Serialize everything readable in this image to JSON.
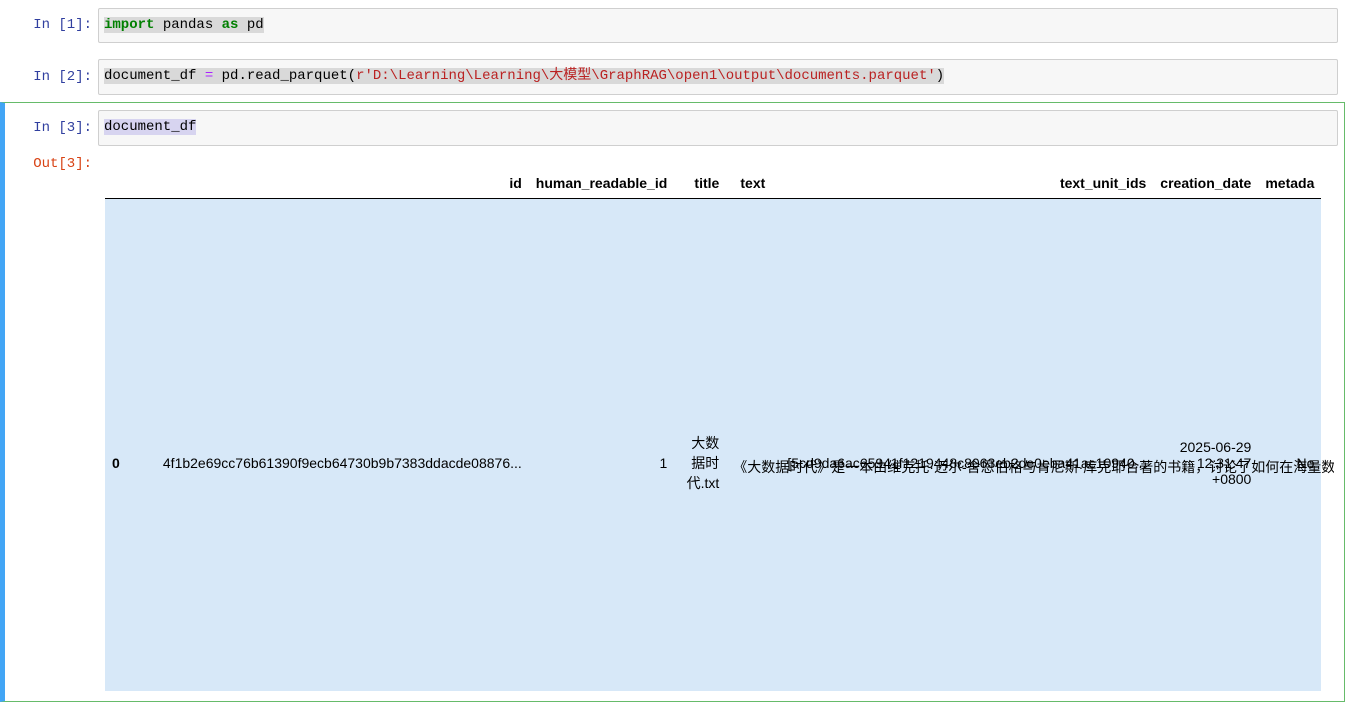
{
  "cells": [
    {
      "prompt": "In  [1]:",
      "code": {
        "kw1": "import",
        "mid": " pandas ",
        "kw2": "as",
        "end": " pd"
      }
    },
    {
      "prompt": "In  [2]:",
      "code": {
        "lhs": "document_df ",
        "eq": "=",
        "call": " pd.read_parquet(",
        "str": "r'D:\\Learning\\Learning\\大模型\\GraphRAG\\open1\\output\\documents.parquet'",
        "close": ")"
      }
    },
    {
      "prompt": "In  [3]:",
      "code": {
        "text": "document_df"
      }
    },
    {
      "out_prompt": "Out[3]:"
    }
  ],
  "table": {
    "columns": [
      "",
      "id",
      "human_readable_id",
      "title",
      "text",
      "text_unit_ids",
      "creation_date",
      "metada"
    ],
    "rows": [
      {
        "index": "0",
        "id": "4f1b2e69cc76b61390f9ecb64730b9b7383ddacde08876...",
        "human_readable_id": "1",
        "title": "大数据时代.txt",
        "text": "《大数据时代》是一本由维克托·迈尔-舍恩伯格与肯尼斯·库克耶合著的书籍，讨论了如何在海量数",
        "text_unit_ids": "[5cd9da6ac65941f1219448c8063eb2de0eba41ac10940...",
        "creation_date": "2025-06-29 12:31:47 +0800",
        "metadata": "No"
      }
    ]
  }
}
